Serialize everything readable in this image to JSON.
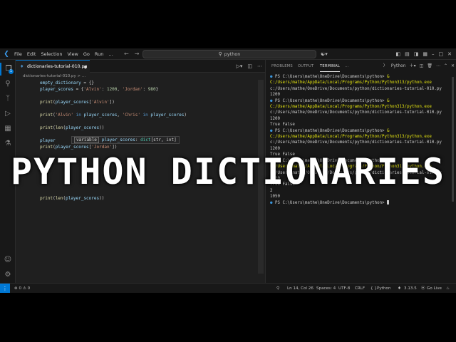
{
  "titlebar": {
    "menus": [
      "File",
      "Edit",
      "Selection",
      "View",
      "Go",
      "Run",
      "…"
    ],
    "search_text": "python"
  },
  "activity": {
    "icons": [
      "explorer-icon",
      "search-icon",
      "source-control-icon",
      "run-debug-icon",
      "extensions-icon",
      "testing-icon",
      "account-icon",
      "settings-gear-icon"
    ],
    "explorer_badge": "1"
  },
  "editor": {
    "tab_name": "dictionaries-tutorial-010.py",
    "breadcrumb": "dictionaries-tutorial-010.py > ...",
    "code": {
      "l1_var": "empty_dictionary",
      "l1_rest": " = {}",
      "l2_var": "player_scores",
      "l2_eq": " = {",
      "l2_k1": "'Alvin'",
      "l2_c1": ": ",
      "l2_v1": "1200",
      "l2_sep": ", ",
      "l2_k2": "'Jordan'",
      "l2_c2": ": ",
      "l2_v2": "980",
      "l2_end": "}",
      "l3_fn": "print",
      "l3_o": "(",
      "l3_var": "player_scores",
      "l3_b": "[",
      "l3_k": "'Alvin'",
      "l3_end": "])",
      "l4_fn": "print",
      "l4_o": "(",
      "l4_s1": "'Alvin'",
      "l4_in1": " in ",
      "l4_v1": "player_scores",
      "l4_sep": ", ",
      "l4_s2": "'Chris'",
      "l4_in2": " in ",
      "l4_v2": "player_scores",
      "l4_end": ")",
      "l5_fn": "print",
      "l5_o": "(",
      "l5_fn2": "len",
      "l5_o2": "(",
      "l5_var": "player_scores",
      "l5_end": "))",
      "l6_var": "player",
      "l7_fn": "print",
      "l7_o": "(",
      "l7_var": "player_scores",
      "l7_b": "[",
      "l7_k": "'Jordan'",
      "l7_end": "])",
      "l8_fn": "print",
      "l8_o": "(",
      "l8_fn2": "len",
      "l8_o2": "(",
      "l8_var": "player_scores",
      "l8_end": "))"
    },
    "hover": {
      "kind": "variable",
      "name": "player_scores",
      "colon": ": ",
      "type": "dict",
      "params": "[str, int]"
    }
  },
  "panel": {
    "tabs": [
      "PROBLEMS",
      "OUTPUT",
      "TERMINAL",
      "…"
    ],
    "active_tab": "TERMINAL",
    "shell": "Python",
    "terminal_lines": [
      {
        "kind": "cmd",
        "prompt": "PS C:\\Users\\mathe\\OneDrive\\Documents\\python> ",
        "command": "& C:/Users/mathe/AppData/Local/Programs/Python/Python313/python.exe",
        "args": " c:/Users/mathe/OneDrive/Documents/python/dictionaries-tutorial-010.py"
      },
      {
        "kind": "out",
        "text": "1200"
      },
      {
        "kind": "cmd",
        "prompt": "PS C:\\Users\\mathe\\OneDrive\\Documents\\python> ",
        "command": "& C:/Users/mathe/AppData/Local/Programs/Python/Python313/python.exe",
        "args": " c:/Users/mathe/OneDrive/Documents/python/dictionaries-tutorial-010.py"
      },
      {
        "kind": "out",
        "text": "1200"
      },
      {
        "kind": "out",
        "text": "True False"
      },
      {
        "kind": "cmd",
        "prompt": "PS C:\\Users\\mathe\\OneDrive\\Documents\\python> ",
        "command": "& C:/Users/mathe/AppData/Local/Programs/Python/Python313/python.exe",
        "args": " c:/Users/mathe/OneDrive/Documents/python/dictionaries-tutorial-010.py"
      },
      {
        "kind": "out",
        "text": "1200"
      },
      {
        "kind": "out",
        "text": "True False"
      },
      {
        "kind": "cmd",
        "prompt": "PS C:\\Users\\mathe\\OneDrive\\Documents\\python> ",
        "command": "& C:/Users/mathe/AppData/Local/Programs/Python/Python313/python.exe",
        "args": " c:/Users/mathe/OneDrive/Documents/python/dictionaries-tutorial-010.py"
      },
      {
        "kind": "out",
        "text": "1200"
      },
      {
        "kind": "out",
        "text": "True False"
      },
      {
        "kind": "out",
        "text": "2"
      },
      {
        "kind": "out",
        "text": "1050"
      },
      {
        "kind": "prompt",
        "prompt": "PS C:\\Users\\mathe\\OneDrive\\Documents\\python> "
      }
    ]
  },
  "statusbar": {
    "errors": "0",
    "warnings": "0",
    "position": "Ln 14, Col 26",
    "spaces": "Spaces: 4",
    "encoding": "UTF-8",
    "eol": "CRLF",
    "language": "Python",
    "python_version": "3.13.5",
    "go_live": "Go Live"
  },
  "overlay": {
    "title": "PYTHON DICTIONARIES"
  }
}
